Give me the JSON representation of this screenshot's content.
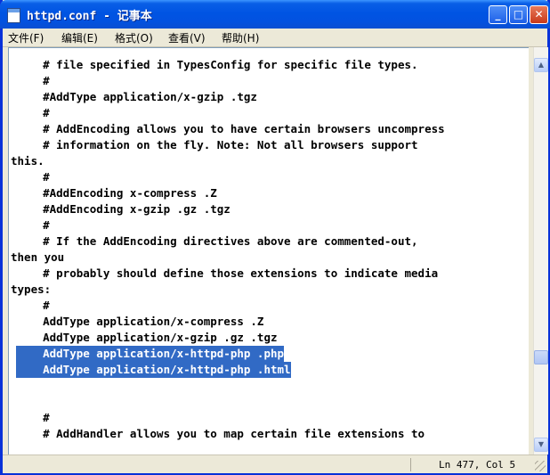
{
  "window": {
    "title": "httpd.conf - 记事本"
  },
  "menu": {
    "file": "文件(F)",
    "edit": "编辑(E)",
    "format": "格式(O)",
    "view": "查看(V)",
    "help": "帮助(H)"
  },
  "editor": {
    "lines": [
      "    # file specified in TypesConfig for specific file types.",
      "    #",
      "    #AddType application/x-gzip .tgz",
      "    #",
      "    # AddEncoding allows you to have certain browsers uncompress",
      "    # information on the fly. Note: Not all browsers support",
      "this.",
      "    #",
      "    #AddEncoding x-compress .Z",
      "    #AddEncoding x-gzip .gz .tgz",
      "    #",
      "    # If the AddEncoding directives above are commented-out,",
      "then you",
      "    # probably should define those extensions to indicate media",
      "types:",
      "    #",
      "    AddType application/x-compress .Z",
      "    AddType application/x-gzip .gz .tgz",
      "    AddType application/x-httpd-php .php",
      "    AddType application/x-httpd-php .html",
      "",
      "",
      "    #",
      "    # AddHandler allows you to map certain file extensions to"
    ]
  },
  "status": {
    "position": "Ln 477, Col 5"
  },
  "icons": {
    "minimize": "minimize-icon",
    "maximize": "maximize-icon",
    "close": "close-icon"
  }
}
